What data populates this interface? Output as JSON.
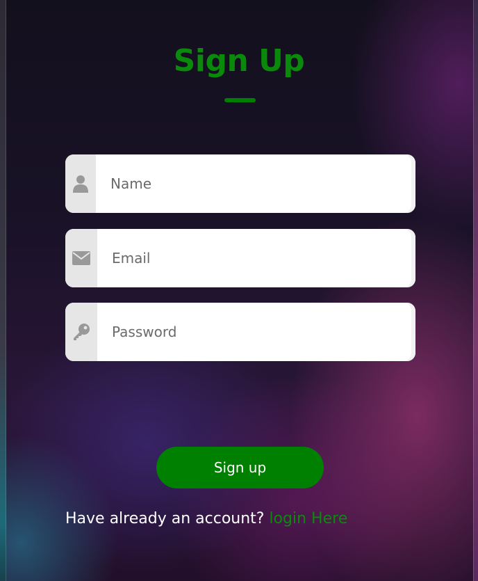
{
  "form": {
    "title": "Sign Up",
    "fields": [
      {
        "placeholder": "Name",
        "value": "",
        "icon": "user-icon"
      },
      {
        "placeholder": "Email",
        "value": "",
        "icon": "envelope-icon"
      },
      {
        "placeholder": "Password",
        "value": "",
        "icon": "key-icon"
      }
    ],
    "submit_label": "Sign up",
    "footer_text": "Have already an account?",
    "footer_link": "login Here"
  },
  "colors": {
    "accent": "#008000",
    "field_bg": "#ffffff",
    "icon_cell_bg": "#e6e6e6",
    "icon": "#999999"
  }
}
